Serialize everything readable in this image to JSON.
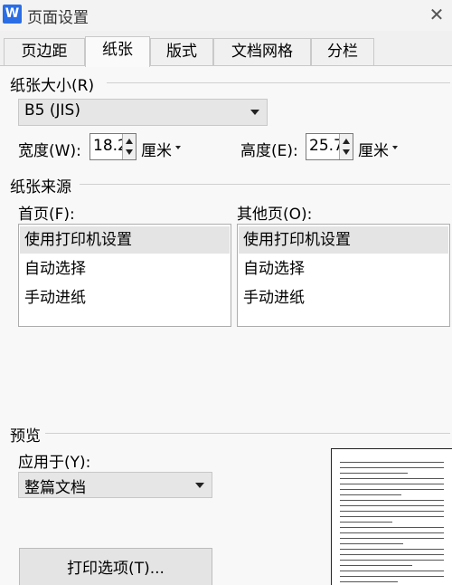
{
  "window": {
    "app_icon": "W",
    "title": "页面设置",
    "close_glyph": "✕"
  },
  "tabs": [
    {
      "label": "页边距",
      "active": false
    },
    {
      "label": "纸张",
      "active": true
    },
    {
      "label": "版式",
      "active": false
    },
    {
      "label": "文档网格",
      "active": false
    },
    {
      "label": "分栏",
      "active": false
    }
  ],
  "paper_size": {
    "group_title": "纸张大小(R)",
    "selected": "B5 (JIS)",
    "width_label": "宽度(W):",
    "width_value": "18.2",
    "width_unit": "厘米",
    "height_label": "高度(E):",
    "height_value": "25.7",
    "height_unit": "厘米"
  },
  "paper_source": {
    "group_title": "纸张来源",
    "first_page_label": "首页(F):",
    "other_pages_label": "其他页(O):",
    "first_page_items": [
      "使用打印机设置",
      "自动选择",
      "手动进纸"
    ],
    "other_pages_items": [
      "使用打印机设置",
      "自动选择",
      "手动进纸"
    ],
    "selected_index": 0
  },
  "preview": {
    "group_title": "预览",
    "apply_label": "应用于(Y):",
    "apply_value": "整篇文档",
    "print_options_button": "打印选项(T)..."
  }
}
